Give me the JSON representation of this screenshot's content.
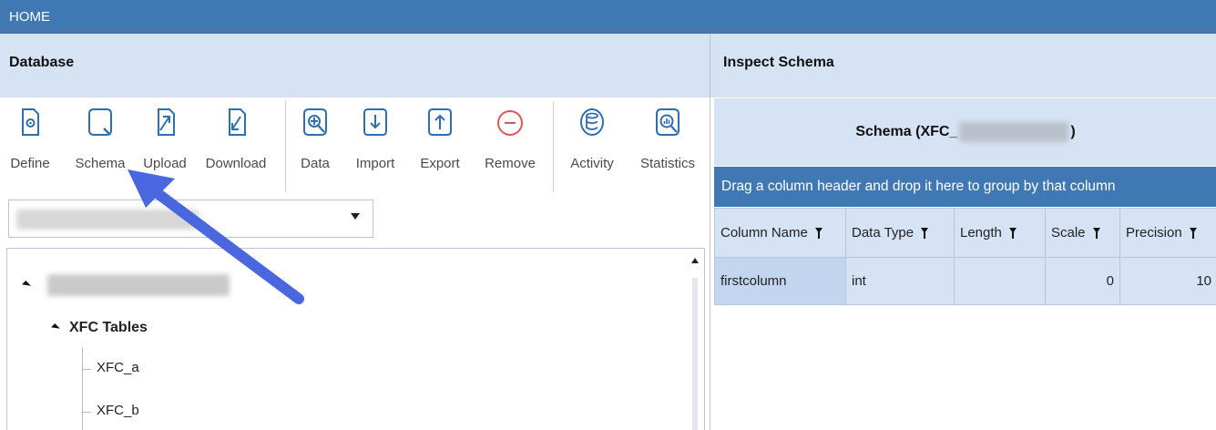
{
  "topbar": {
    "title": "HOME"
  },
  "left_panel": {
    "title": "Database",
    "toolbar": [
      {
        "label": "Define",
        "icon": "define-icon"
      },
      {
        "label": "Schema",
        "icon": "schema-icon"
      },
      {
        "label": "Upload",
        "icon": "upload-icon"
      },
      {
        "label": "Download",
        "icon": "download-icon"
      },
      {
        "label": "Data",
        "icon": "data-icon"
      },
      {
        "label": "Import",
        "icon": "import-icon"
      },
      {
        "label": "Export",
        "icon": "export-icon"
      },
      {
        "label": "Remove",
        "icon": "remove-icon"
      },
      {
        "label": "Activity",
        "icon": "activity-icon"
      },
      {
        "label": "Statistics",
        "icon": "statistics-icon"
      }
    ],
    "tree": {
      "folder_label": "XFC Tables",
      "tables": [
        "XFC_a",
        "XFC_b"
      ]
    }
  },
  "right_panel": {
    "title": "Inspect Schema",
    "schema_prefix": "Schema (XFC_",
    "schema_suffix": ")",
    "group_hint": "Drag a column header and drop it here to group by that column",
    "columns": [
      "Column Name",
      "Data Type",
      "Length",
      "Scale",
      "Precision"
    ],
    "rows": [
      {
        "column_name": "firstcolumn",
        "data_type": "int",
        "length": "",
        "scale": "0",
        "precision": "10"
      }
    ]
  },
  "colors": {
    "topbar": "#3f78b3",
    "panel_header": "#d5e3f5",
    "remove_accent": "#e0555a",
    "pointer_arrow": "#4a67e0"
  }
}
